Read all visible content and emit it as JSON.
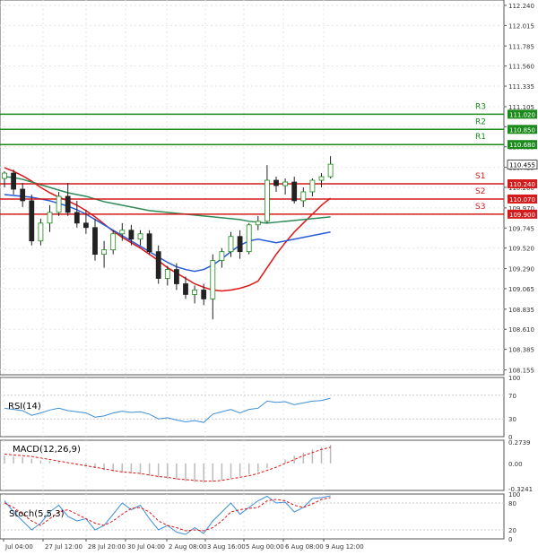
{
  "chart_data": [
    {
      "type": "candlestick",
      "panel": "price",
      "yticks": [
        112.24,
        112.015,
        111.785,
        111.56,
        111.335,
        111.105,
        110.88,
        110.655,
        110.425,
        110.2,
        109.97,
        109.745,
        109.52,
        109.29,
        109.065,
        108.835,
        108.61,
        108.385,
        108.155
      ],
      "ylim": [
        108.1,
        112.3
      ],
      "xticks": [
        "Jul 04:00",
        "27 Jul 12:00",
        "28 Jul 20:00",
        "30 Jul 04:00",
        "2 Aug 08:00",
        "3 Aug 16:00",
        "5 Aug 00:00",
        "6 Aug 08:00",
        "9 Aug 12:00"
      ],
      "current_price": "110.455",
      "levels": [
        {
          "label": "R3",
          "value": 111.02,
          "tag": "111.020",
          "color": "#1a8a1a"
        },
        {
          "label": "R2",
          "value": 110.85,
          "tag": "110.850",
          "color": "#1a8a1a"
        },
        {
          "label": "R1",
          "value": 110.68,
          "tag": "110.680",
          "color": "#1a8a1a"
        },
        {
          "label": "S1",
          "value": 110.24,
          "tag": "110.240",
          "color": "#d41a1a"
        },
        {
          "label": "S2",
          "value": 110.07,
          "tag": "110.070",
          "color": "#d41a1a"
        },
        {
          "label": "S3",
          "value": 109.9,
          "tag": "109.900",
          "color": "#d41a1a"
        }
      ],
      "candles": [
        {
          "o": 110.3,
          "h": 110.38,
          "l": 110.2,
          "c": 110.36
        },
        {
          "o": 110.36,
          "h": 110.4,
          "l": 110.12,
          "c": 110.18
        },
        {
          "o": 110.18,
          "h": 110.25,
          "l": 109.98,
          "c": 110.05
        },
        {
          "o": 110.05,
          "h": 110.12,
          "l": 109.55,
          "c": 109.6
        },
        {
          "o": 109.6,
          "h": 109.85,
          "l": 109.55,
          "c": 109.8
        },
        {
          "o": 109.8,
          "h": 110.0,
          "l": 109.7,
          "c": 109.92
        },
        {
          "o": 109.92,
          "h": 110.15,
          "l": 109.88,
          "c": 110.1
        },
        {
          "o": 110.1,
          "h": 110.25,
          "l": 109.88,
          "c": 109.92
        },
        {
          "o": 109.92,
          "h": 110.05,
          "l": 109.75,
          "c": 109.8
        },
        {
          "o": 109.8,
          "h": 109.95,
          "l": 109.68,
          "c": 109.75
        },
        {
          "o": 109.75,
          "h": 109.85,
          "l": 109.38,
          "c": 109.45
        },
        {
          "o": 109.45,
          "h": 109.6,
          "l": 109.3,
          "c": 109.5
        },
        {
          "o": 109.5,
          "h": 109.72,
          "l": 109.45,
          "c": 109.68
        },
        {
          "o": 109.68,
          "h": 109.8,
          "l": 109.6,
          "c": 109.72
        },
        {
          "o": 109.72,
          "h": 109.78,
          "l": 109.55,
          "c": 109.62
        },
        {
          "o": 109.62,
          "h": 109.72,
          "l": 109.55,
          "c": 109.68
        },
        {
          "o": 109.68,
          "h": 109.72,
          "l": 109.45,
          "c": 109.48
        },
        {
          "o": 109.48,
          "h": 109.55,
          "l": 109.12,
          "c": 109.18
        },
        {
          "o": 109.18,
          "h": 109.32,
          "l": 109.1,
          "c": 109.28
        },
        {
          "o": 109.28,
          "h": 109.35,
          "l": 109.05,
          "c": 109.12
        },
        {
          "o": 109.12,
          "h": 109.2,
          "l": 108.95,
          "c": 109.0
        },
        {
          "o": 109.0,
          "h": 109.1,
          "l": 108.9,
          "c": 109.05
        },
        {
          "o": 109.05,
          "h": 109.12,
          "l": 108.88,
          "c": 108.95
        },
        {
          "o": 108.95,
          "h": 109.45,
          "l": 108.72,
          "c": 109.38
        },
        {
          "o": 109.38,
          "h": 109.52,
          "l": 109.3,
          "c": 109.48
        },
        {
          "o": 109.48,
          "h": 109.7,
          "l": 109.42,
          "c": 109.65
        },
        {
          "o": 109.65,
          "h": 109.72,
          "l": 109.4,
          "c": 109.48
        },
        {
          "o": 109.48,
          "h": 109.8,
          "l": 109.45,
          "c": 109.78
        },
        {
          "o": 109.78,
          "h": 109.88,
          "l": 109.72,
          "c": 109.82
        },
        {
          "o": 109.82,
          "h": 110.45,
          "l": 109.8,
          "c": 110.28
        },
        {
          "o": 110.28,
          "h": 110.32,
          "l": 110.15,
          "c": 110.22
        },
        {
          "o": 110.22,
          "h": 110.3,
          "l": 110.12,
          "c": 110.26
        },
        {
          "o": 110.26,
          "h": 110.32,
          "l": 110.02,
          "c": 110.05
        },
        {
          "o": 110.05,
          "h": 110.2,
          "l": 109.98,
          "c": 110.15
        },
        {
          "o": 110.15,
          "h": 110.3,
          "l": 110.1,
          "c": 110.28
        },
        {
          "o": 110.28,
          "h": 110.36,
          "l": 110.2,
          "c": 110.32
        },
        {
          "o": 110.32,
          "h": 110.55,
          "l": 110.3,
          "c": 110.46
        }
      ],
      "moving_averages": [
        {
          "color": "#e01414",
          "values": [
            110.42,
            110.38,
            110.33,
            110.27,
            110.2,
            110.14,
            110.09,
            110.05,
            110.0,
            109.94,
            109.87,
            109.79,
            109.71,
            109.64,
            109.58,
            109.52,
            109.45,
            109.38,
            109.3,
            109.24,
            109.18,
            109.12,
            109.08,
            109.05,
            109.04,
            109.05,
            109.07,
            109.1,
            109.15,
            109.3,
            109.45,
            109.58,
            109.7,
            109.8,
            109.9,
            110.0,
            110.08
          ]
        },
        {
          "color": "#2e8b57",
          "values": [
            110.32,
            110.31,
            110.29,
            110.26,
            110.23,
            110.2,
            110.17,
            110.14,
            110.12,
            110.1,
            110.07,
            110.04,
            110.02,
            110.0,
            109.98,
            109.96,
            109.94,
            109.93,
            109.92,
            109.91,
            109.9,
            109.89,
            109.88,
            109.87,
            109.86,
            109.85,
            109.84,
            109.82,
            109.81,
            109.8,
            109.81,
            109.82,
            109.83,
            109.84,
            109.85,
            109.86,
            109.87
          ]
        },
        {
          "color": "#2a5bd7",
          "values": [
            110.12,
            110.11,
            110.1,
            110.09,
            110.07,
            110.05,
            110.02,
            109.99,
            109.95,
            109.9,
            109.84,
            109.78,
            109.72,
            109.66,
            109.6,
            109.54,
            109.48,
            109.42,
            109.36,
            109.31,
            109.28,
            109.26,
            109.28,
            109.33,
            109.4,
            109.48,
            109.55,
            109.6,
            109.62,
            109.6,
            109.58,
            109.6,
            109.62,
            109.64,
            109.66,
            109.68,
            109.7
          ]
        }
      ]
    },
    {
      "type": "line",
      "panel": "rsi",
      "label": "RSI(14)",
      "yticks": [
        100,
        70,
        30,
        0
      ],
      "ylim": [
        0,
        100
      ],
      "values": [
        48,
        46,
        44,
        36,
        40,
        45,
        48,
        44,
        42,
        40,
        33,
        35,
        40,
        43,
        41,
        42,
        38,
        30,
        32,
        28,
        25,
        27,
        24,
        38,
        42,
        46,
        40,
        46,
        48,
        60,
        58,
        59,
        54,
        57,
        60,
        61,
        65
      ]
    },
    {
      "type": "bar+line",
      "panel": "macd",
      "label": "MACD(12,26,9)",
      "yticks": [
        0.2739,
        0.0,
        -0.3241
      ],
      "ylim": [
        -0.35,
        0.3
      ],
      "histogram": [
        0.1,
        0.09,
        0.08,
        0.06,
        0.04,
        0.03,
        0.02,
        0.0,
        -0.02,
        -0.04,
        -0.06,
        -0.09,
        -0.11,
        -0.12,
        -0.13,
        -0.14,
        -0.16,
        -0.18,
        -0.2,
        -0.21,
        -0.23,
        -0.24,
        -0.25,
        -0.24,
        -0.22,
        -0.19,
        -0.17,
        -0.14,
        -0.11,
        -0.06,
        0.0,
        0.05,
        0.1,
        0.14,
        0.18,
        0.21,
        0.24
      ],
      "signal": [
        0.12,
        0.11,
        0.1,
        0.09,
        0.07,
        0.05,
        0.03,
        0.01,
        -0.01,
        -0.03,
        -0.05,
        -0.07,
        -0.09,
        -0.11,
        -0.12,
        -0.13,
        -0.15,
        -0.17,
        -0.18,
        -0.2,
        -0.21,
        -0.22,
        -0.23,
        -0.23,
        -0.22,
        -0.2,
        -0.18,
        -0.16,
        -0.13,
        -0.09,
        -0.05,
        0.0,
        0.05,
        0.1,
        0.14,
        0.18,
        0.21
      ]
    },
    {
      "type": "line",
      "panel": "stoch",
      "label": "Stoch(5,5,3)",
      "yticks": [
        100,
        80,
        20,
        0
      ],
      "ylim": [
        0,
        100
      ],
      "k": [
        85,
        60,
        40,
        20,
        35,
        60,
        75,
        50,
        40,
        45,
        20,
        30,
        55,
        80,
        65,
        75,
        45,
        20,
        30,
        15,
        10,
        25,
        12,
        40,
        60,
        80,
        55,
        70,
        85,
        95,
        80,
        82,
        60,
        70,
        90,
        92,
        96
      ],
      "d": [
        80,
        70,
        55,
        40,
        30,
        45,
        60,
        65,
        55,
        45,
        35,
        30,
        40,
        55,
        68,
        70,
        60,
        40,
        30,
        25,
        18,
        20,
        18,
        25,
        40,
        60,
        65,
        68,
        70,
        85,
        88,
        85,
        75,
        70,
        78,
        88,
        92
      ]
    }
  ]
}
